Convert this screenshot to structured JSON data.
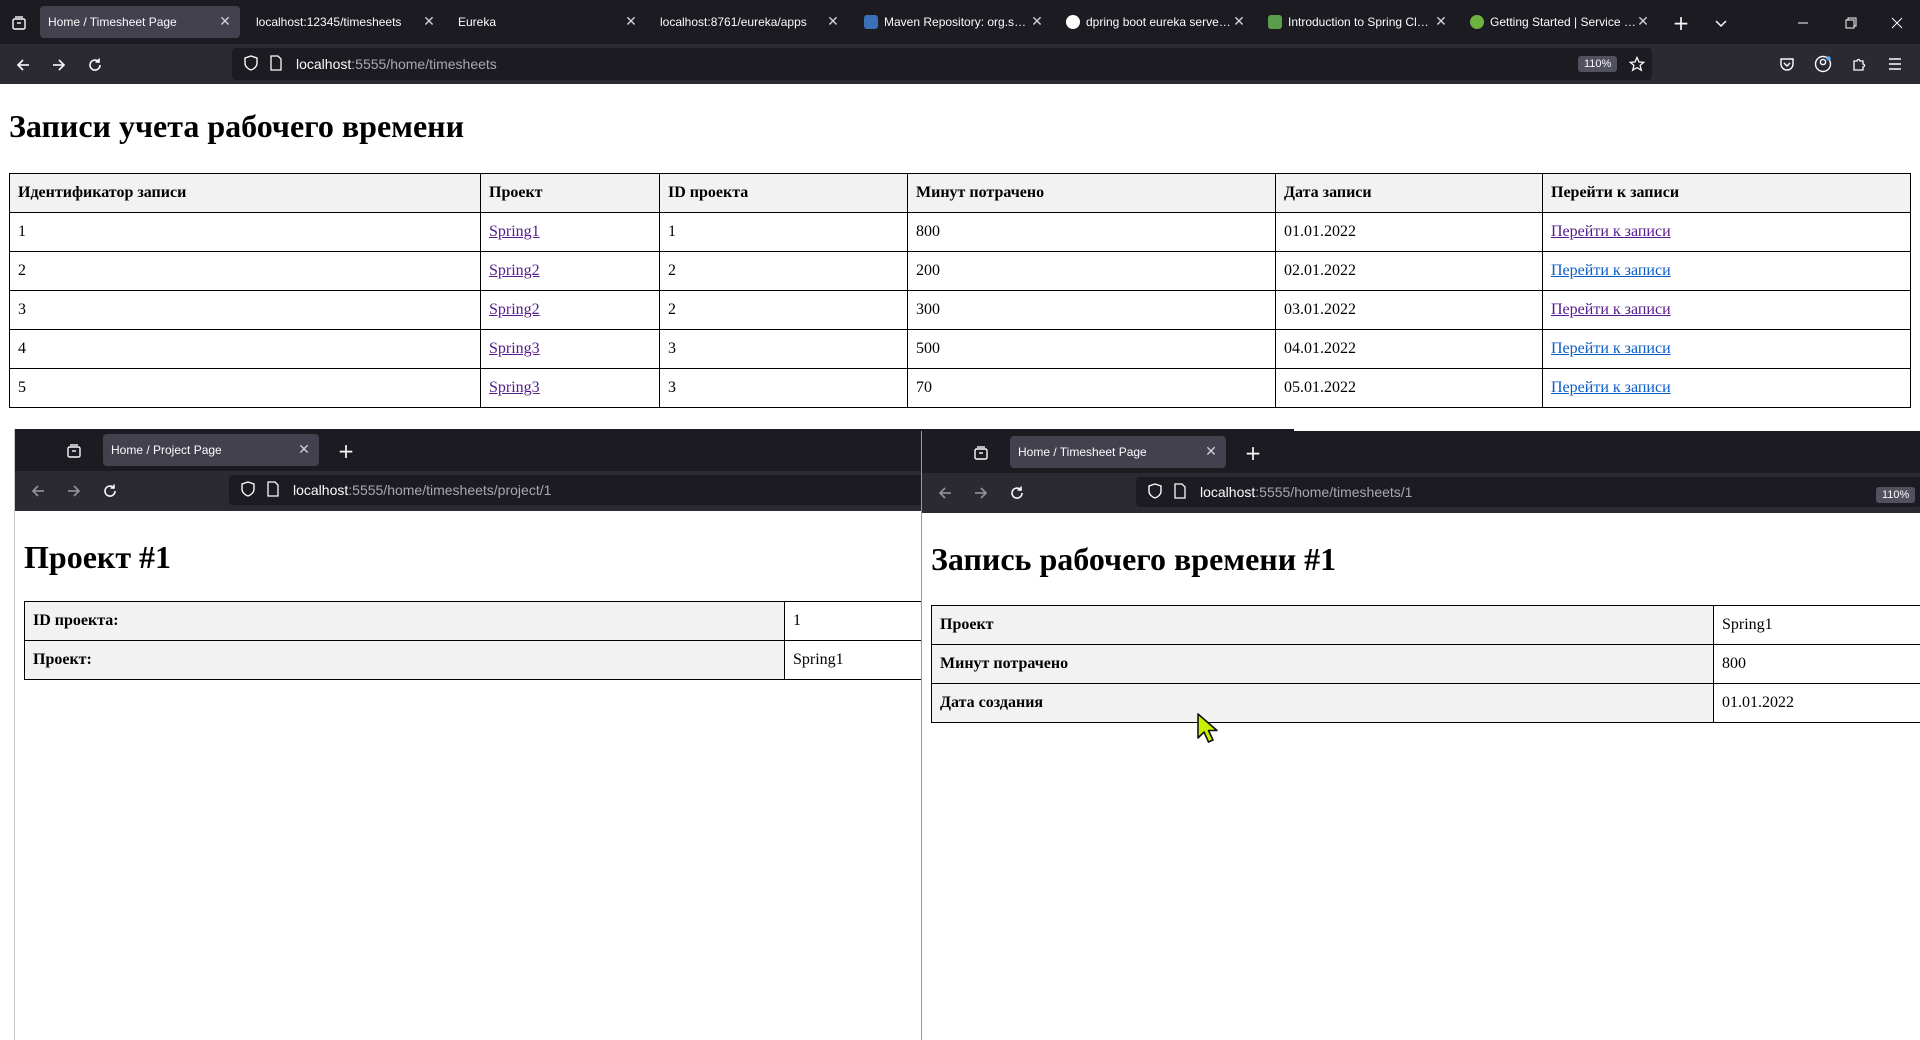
{
  "browser": {
    "tabs": [
      {
        "label": "Home / Timesheet Page",
        "active": true,
        "favicon": ""
      },
      {
        "label": "localhost:12345/timesheets",
        "active": false,
        "favicon": ""
      },
      {
        "label": "Eureka",
        "active": false,
        "favicon": ""
      },
      {
        "label": "localhost:8761/eureka/apps",
        "active": false,
        "favicon": ""
      },
      {
        "label": "Maven Repository: org.springframework",
        "active": false,
        "favicon": "#3b6fb6"
      },
      {
        "label": "dpring boot eureka server - Google",
        "active": false,
        "favicon": "#ffffff"
      },
      {
        "label": "Introduction to Spring Cloud",
        "active": false,
        "favicon": "#5a9e4b"
      },
      {
        "label": "Getting Started | Service Registration",
        "active": false,
        "favicon": "#6db33f"
      }
    ],
    "url_host": "localhost",
    "url_path": ":5555/home/timesheets",
    "zoom": "110%"
  },
  "main_page": {
    "heading": "Записи учета рабочего времени",
    "columns": [
      "Идентификатор записи",
      "Проект",
      "ID проекта",
      "Минут потрачено",
      "Дата записи",
      "Перейти к записи"
    ],
    "rows": [
      {
        "id": "1",
        "project": "Spring1",
        "project_id": "1",
        "minutes": "800",
        "date": "01.01.2022",
        "link": "Перейти к записи"
      },
      {
        "id": "2",
        "project": "Spring2",
        "project_id": "2",
        "minutes": "200",
        "date": "02.01.2022",
        "link": "Перейти к записи"
      },
      {
        "id": "3",
        "project": "Spring2",
        "project_id": "2",
        "minutes": "300",
        "date": "03.01.2022",
        "link": "Перейти к записи"
      },
      {
        "id": "4",
        "project": "Spring3",
        "project_id": "3",
        "minutes": "500",
        "date": "04.01.2022",
        "link": "Перейти к записи"
      },
      {
        "id": "5",
        "project": "Spring3",
        "project_id": "3",
        "minutes": "70",
        "date": "05.01.2022",
        "link": "Перейти к записи"
      }
    ]
  },
  "project_window": {
    "tab_label": "Home / Project Page",
    "url_host": "localhost",
    "url_path": ":5555/home/timesheets/project/1",
    "heading": "Проект #1",
    "rows": [
      {
        "label": "ID проекта:",
        "value": "1"
      },
      {
        "label": "Проект:",
        "value": "Spring1"
      }
    ]
  },
  "timesheet_window": {
    "tab_label": "Home / Timesheet Page",
    "url_host": "localhost",
    "url_path": ":5555/home/timesheets/1",
    "zoom": "110%",
    "heading": "Запись рабочего времени #1",
    "rows": [
      {
        "label": "Проект",
        "value": "Spring1"
      },
      {
        "label": "Минут потрачено",
        "value": "800"
      },
      {
        "label": "Дата создания",
        "value": "01.01.2022"
      }
    ]
  },
  "colors": {
    "chrome_dark": "#1c1b22",
    "toolbar": "#2b2a33",
    "active_tab": "#42414d",
    "visited_link": "#551a8b",
    "link": "#0b5cc6",
    "header_cell": "#f2f2f2"
  },
  "icons": [
    "tab-list-icon",
    "back-arrow-icon",
    "forward-arrow-icon",
    "reload-icon",
    "shield-icon",
    "page-icon",
    "star-icon",
    "pocket-icon",
    "account-icon",
    "extensions-icon",
    "menu-icon",
    "new-tab-icon",
    "chevron-down-icon",
    "minimize-icon",
    "restore-icon",
    "close-icon",
    "mouse-cursor-icon"
  ]
}
